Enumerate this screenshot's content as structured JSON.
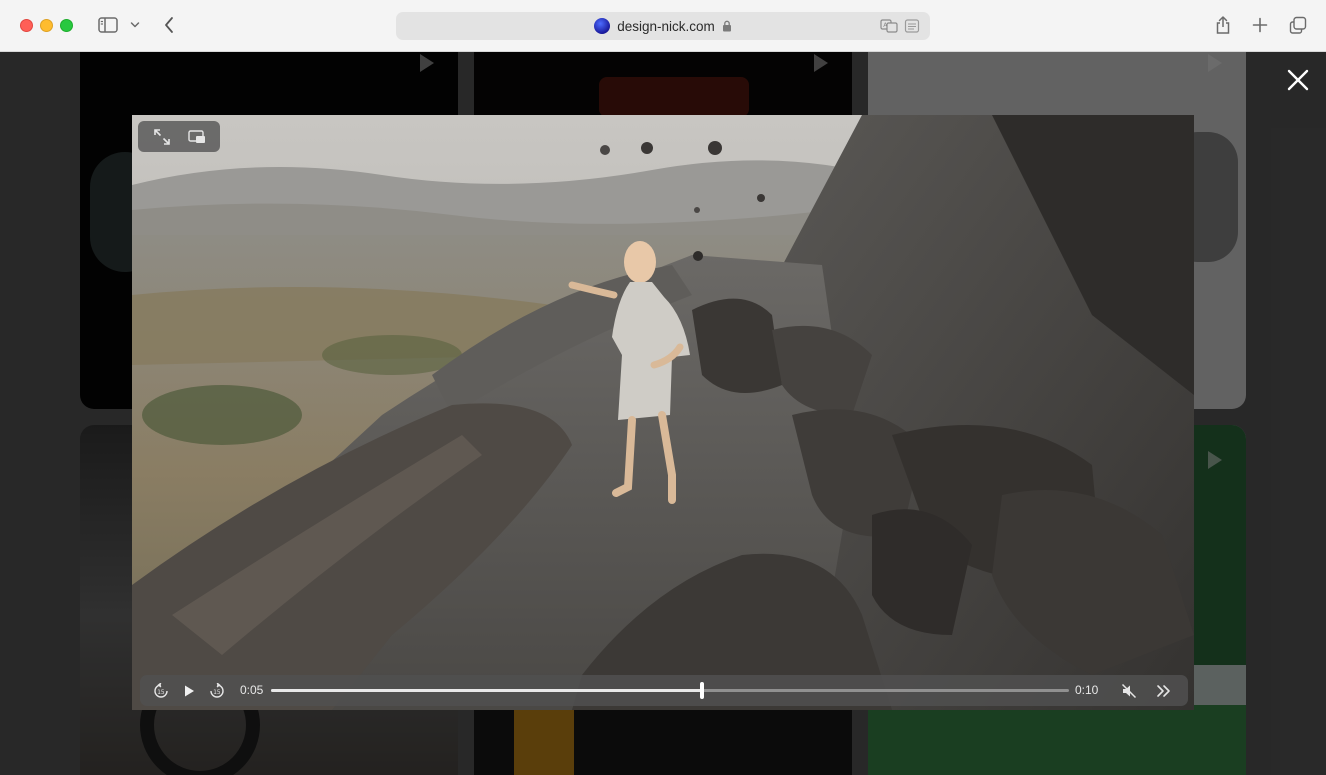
{
  "browser": {
    "url": "design-nick.com",
    "colors": {
      "close": "#ff5f57",
      "minimize": "#febc2e",
      "maximize": "#28c840"
    }
  },
  "video": {
    "current_time": "0:05",
    "duration": "0:10",
    "progress_fraction": 0.54
  },
  "icons": {
    "sidebar": "sidebar-icon",
    "tab_overview": "tabs-icon",
    "share": "share-icon",
    "new_tab": "plus-icon",
    "close_overlay": "close-icon",
    "fullscreen": "expand-icon",
    "pip": "picture-in-picture-icon",
    "skip_back": "skip-back-15-icon",
    "play": "play-icon",
    "skip_forward": "skip-forward-15-icon",
    "mute": "muted-speaker-icon",
    "more": "double-chevron-right-icon"
  }
}
